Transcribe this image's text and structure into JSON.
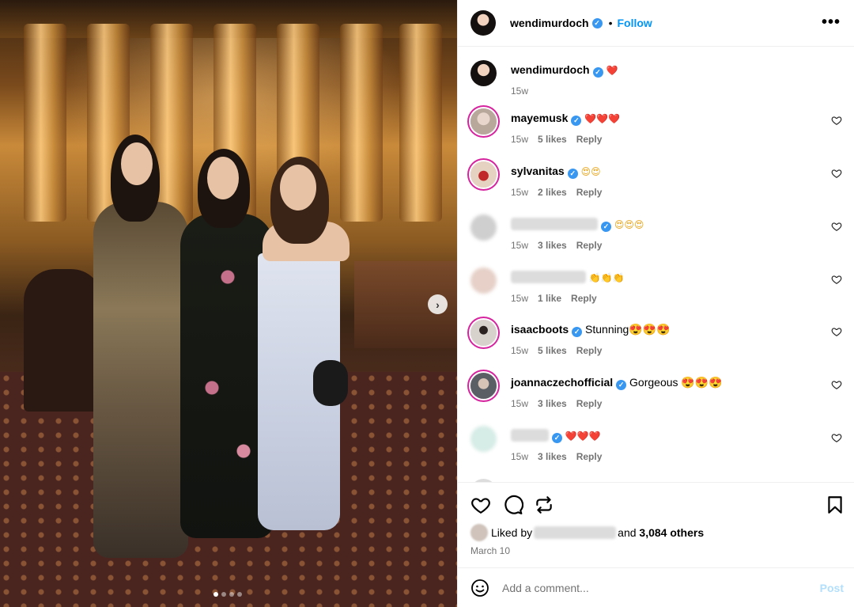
{
  "header": {
    "username": "wendimurdoch",
    "separator": "•",
    "follow_label": "Follow",
    "more_label": "•••"
  },
  "caption": {
    "username": "wendimurdoch",
    "text": "❤️",
    "time": "15w"
  },
  "comments": [
    {
      "username": "mayemusk",
      "verified": true,
      "text": "❤️❤️❤️",
      "time": "15w",
      "likes": "5 likes",
      "reply": "Reply",
      "blurred": false
    },
    {
      "username": "sylvanitas",
      "verified": true,
      "text": "😍😍",
      "time": "15w",
      "likes": "2 likes",
      "reply": "Reply",
      "blurred": false
    },
    {
      "username": "",
      "verified": true,
      "text": "😍😍😍",
      "time": "15w",
      "likes": "3 likes",
      "reply": "Reply",
      "blurred": true
    },
    {
      "username": "",
      "verified": false,
      "text": "👏👏👏",
      "time": "15w",
      "likes": "1 like",
      "reply": "Reply",
      "blurred": true
    },
    {
      "username": "isaacboots",
      "verified": true,
      "text": "Stunning😍😍😍",
      "time": "15w",
      "likes": "5 likes",
      "reply": "Reply",
      "blurred": false
    },
    {
      "username": "joannaczechofficial",
      "verified": true,
      "text": "Gorgeous 😍😍😍",
      "time": "15w",
      "likes": "3 likes",
      "reply": "Reply",
      "blurred": false
    },
    {
      "username": "",
      "verified": true,
      "text": "❤️❤️❤️",
      "time": "15w",
      "likes": "3 likes",
      "reply": "Reply",
      "blurred": true
    }
  ],
  "likes": {
    "prefix": "Liked by",
    "middle": "and",
    "others": "3,084 others"
  },
  "date": "March 10",
  "add_comment": {
    "placeholder": "Add a comment...",
    "post_label": "Post"
  },
  "colors": {
    "accent": "#0095f6",
    "verified": "#3897f0",
    "meta": "#737373",
    "post_disabled": "#b2dffc"
  },
  "carousel": {
    "total_slides": 4,
    "active_slide": 1
  },
  "icons": [
    "heart-icon",
    "comment-icon",
    "share-icon",
    "bookmark-icon",
    "emoji-icon",
    "chevron-right-icon",
    "more-icon",
    "verified-icon"
  ]
}
